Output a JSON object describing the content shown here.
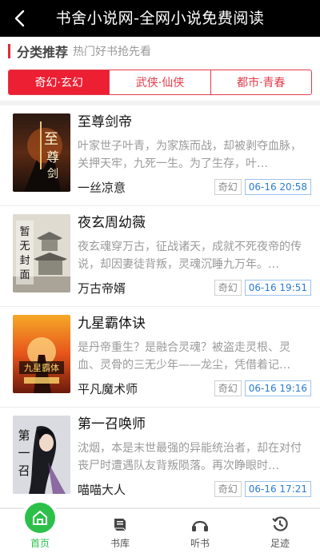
{
  "header": {
    "title": "书舍小说网-全网小说免费阅读"
  },
  "section": {
    "title": "分类推荐",
    "subtitle": "热门好书抢先看"
  },
  "tabs": [
    {
      "label": "奇幻·玄幻",
      "active": true
    },
    {
      "label": "武侠·仙侠",
      "active": false
    },
    {
      "label": "都市·青春",
      "active": false
    }
  ],
  "books": [
    {
      "title": "至尊剑帝",
      "desc": "叶家世子叶青，为家族而战，却被剥夺血脉，关押天牢，九死一生。为了生存，叶…",
      "author": "一丝凉意",
      "category": "奇幻",
      "time": "06-16 20:58",
      "cover_text": "至尊剑帝"
    },
    {
      "title": "夜玄周幼薇",
      "desc": "夜玄魂穿万古，征战诸天，成就不死夜帝的传说，却因妻徒背叛，灵魂沉睡九万年。…",
      "author": "万古帝婿",
      "category": "奇幻",
      "time": "06-16 19:51",
      "cover_text": "暂无封面"
    },
    {
      "title": "九星霸体诀",
      "desc": "是丹帝重生？是融合灵魂？被盗走灵根、灵血、灵骨的三无少年——龙尘，凭借着记…",
      "author": "平凡魔术师",
      "category": "奇幻",
      "time": "06-16 19:16",
      "cover_text": "九星霸体诀"
    },
    {
      "title": "第一召唤师",
      "desc": "沈烟，本是末世最强的异能统治者，却在对付丧尸时遭遇队友背叛陨落。再次睁眼时…",
      "author": "喵喵大人",
      "category": "奇幻",
      "time": "06-16 17:21",
      "cover_text": "第一召唤师"
    }
  ],
  "tabbar": [
    {
      "label": "首页",
      "icon": "home-icon",
      "active": true
    },
    {
      "label": "书库",
      "icon": "book-icon",
      "active": false
    },
    {
      "label": "听书",
      "icon": "headphones-icon",
      "active": false
    },
    {
      "label": "足迹",
      "icon": "history-icon",
      "active": false
    }
  ],
  "colors": {
    "accent": "#ec1f33",
    "tabbar_active": "#2cc04a",
    "time_blue": "#2a7bd1"
  }
}
